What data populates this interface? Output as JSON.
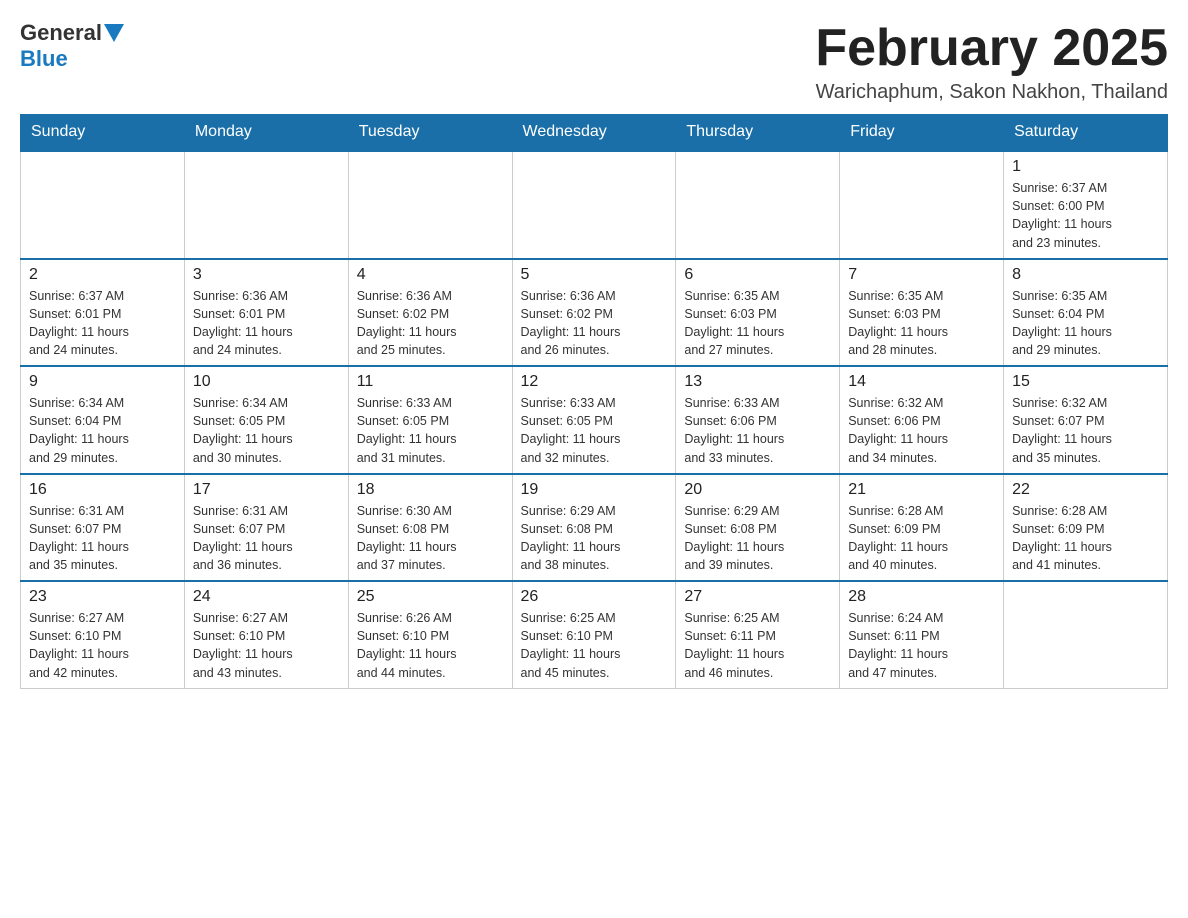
{
  "header": {
    "logo_general": "General",
    "logo_blue": "Blue",
    "title": "February 2025",
    "subtitle": "Warichaphum, Sakon Nakhon, Thailand"
  },
  "days_of_week": [
    "Sunday",
    "Monday",
    "Tuesday",
    "Wednesday",
    "Thursday",
    "Friday",
    "Saturday"
  ],
  "weeks": [
    [
      {
        "day": "",
        "info": ""
      },
      {
        "day": "",
        "info": ""
      },
      {
        "day": "",
        "info": ""
      },
      {
        "day": "",
        "info": ""
      },
      {
        "day": "",
        "info": ""
      },
      {
        "day": "",
        "info": ""
      },
      {
        "day": "1",
        "info": "Sunrise: 6:37 AM\nSunset: 6:00 PM\nDaylight: 11 hours\nand 23 minutes."
      }
    ],
    [
      {
        "day": "2",
        "info": "Sunrise: 6:37 AM\nSunset: 6:01 PM\nDaylight: 11 hours\nand 24 minutes."
      },
      {
        "day": "3",
        "info": "Sunrise: 6:36 AM\nSunset: 6:01 PM\nDaylight: 11 hours\nand 24 minutes."
      },
      {
        "day": "4",
        "info": "Sunrise: 6:36 AM\nSunset: 6:02 PM\nDaylight: 11 hours\nand 25 minutes."
      },
      {
        "day": "5",
        "info": "Sunrise: 6:36 AM\nSunset: 6:02 PM\nDaylight: 11 hours\nand 26 minutes."
      },
      {
        "day": "6",
        "info": "Sunrise: 6:35 AM\nSunset: 6:03 PM\nDaylight: 11 hours\nand 27 minutes."
      },
      {
        "day": "7",
        "info": "Sunrise: 6:35 AM\nSunset: 6:03 PM\nDaylight: 11 hours\nand 28 minutes."
      },
      {
        "day": "8",
        "info": "Sunrise: 6:35 AM\nSunset: 6:04 PM\nDaylight: 11 hours\nand 29 minutes."
      }
    ],
    [
      {
        "day": "9",
        "info": "Sunrise: 6:34 AM\nSunset: 6:04 PM\nDaylight: 11 hours\nand 29 minutes."
      },
      {
        "day": "10",
        "info": "Sunrise: 6:34 AM\nSunset: 6:05 PM\nDaylight: 11 hours\nand 30 minutes."
      },
      {
        "day": "11",
        "info": "Sunrise: 6:33 AM\nSunset: 6:05 PM\nDaylight: 11 hours\nand 31 minutes."
      },
      {
        "day": "12",
        "info": "Sunrise: 6:33 AM\nSunset: 6:05 PM\nDaylight: 11 hours\nand 32 minutes."
      },
      {
        "day": "13",
        "info": "Sunrise: 6:33 AM\nSunset: 6:06 PM\nDaylight: 11 hours\nand 33 minutes."
      },
      {
        "day": "14",
        "info": "Sunrise: 6:32 AM\nSunset: 6:06 PM\nDaylight: 11 hours\nand 34 minutes."
      },
      {
        "day": "15",
        "info": "Sunrise: 6:32 AM\nSunset: 6:07 PM\nDaylight: 11 hours\nand 35 minutes."
      }
    ],
    [
      {
        "day": "16",
        "info": "Sunrise: 6:31 AM\nSunset: 6:07 PM\nDaylight: 11 hours\nand 35 minutes."
      },
      {
        "day": "17",
        "info": "Sunrise: 6:31 AM\nSunset: 6:07 PM\nDaylight: 11 hours\nand 36 minutes."
      },
      {
        "day": "18",
        "info": "Sunrise: 6:30 AM\nSunset: 6:08 PM\nDaylight: 11 hours\nand 37 minutes."
      },
      {
        "day": "19",
        "info": "Sunrise: 6:29 AM\nSunset: 6:08 PM\nDaylight: 11 hours\nand 38 minutes."
      },
      {
        "day": "20",
        "info": "Sunrise: 6:29 AM\nSunset: 6:08 PM\nDaylight: 11 hours\nand 39 minutes."
      },
      {
        "day": "21",
        "info": "Sunrise: 6:28 AM\nSunset: 6:09 PM\nDaylight: 11 hours\nand 40 minutes."
      },
      {
        "day": "22",
        "info": "Sunrise: 6:28 AM\nSunset: 6:09 PM\nDaylight: 11 hours\nand 41 minutes."
      }
    ],
    [
      {
        "day": "23",
        "info": "Sunrise: 6:27 AM\nSunset: 6:10 PM\nDaylight: 11 hours\nand 42 minutes."
      },
      {
        "day": "24",
        "info": "Sunrise: 6:27 AM\nSunset: 6:10 PM\nDaylight: 11 hours\nand 43 minutes."
      },
      {
        "day": "25",
        "info": "Sunrise: 6:26 AM\nSunset: 6:10 PM\nDaylight: 11 hours\nand 44 minutes."
      },
      {
        "day": "26",
        "info": "Sunrise: 6:25 AM\nSunset: 6:10 PM\nDaylight: 11 hours\nand 45 minutes."
      },
      {
        "day": "27",
        "info": "Sunrise: 6:25 AM\nSunset: 6:11 PM\nDaylight: 11 hours\nand 46 minutes."
      },
      {
        "day": "28",
        "info": "Sunrise: 6:24 AM\nSunset: 6:11 PM\nDaylight: 11 hours\nand 47 minutes."
      },
      {
        "day": "",
        "info": ""
      }
    ]
  ]
}
